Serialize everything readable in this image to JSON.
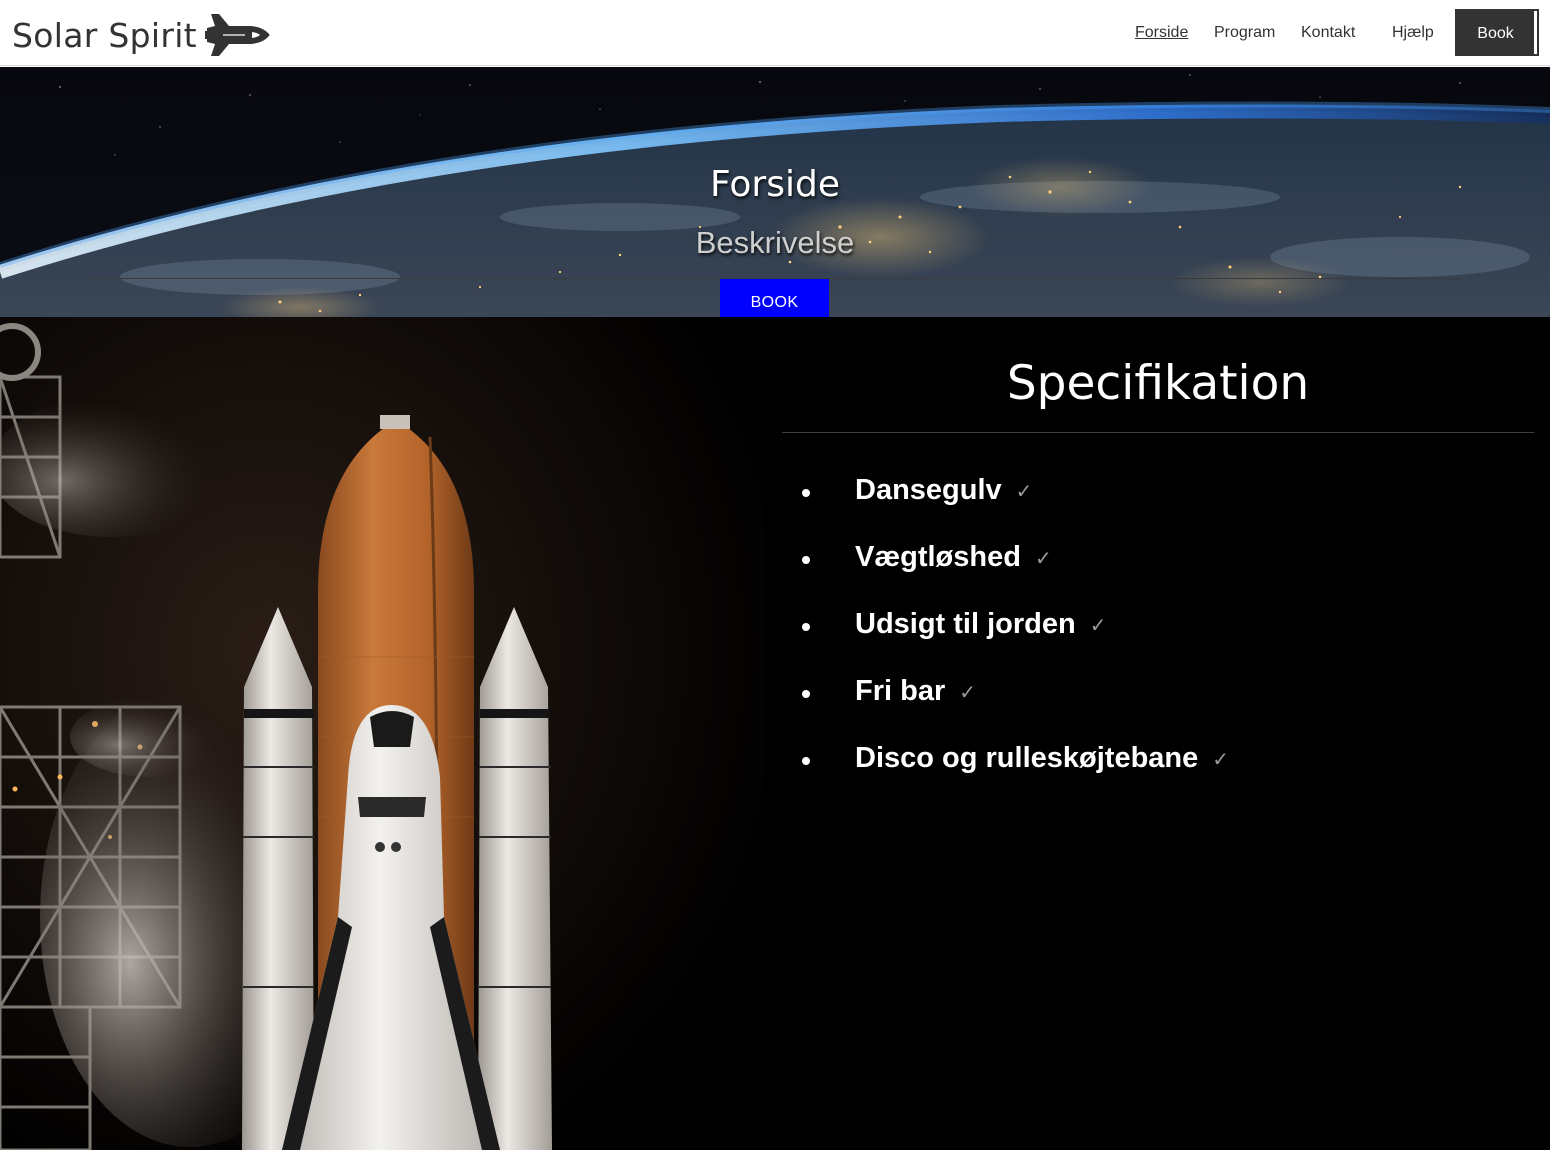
{
  "brand": {
    "name": "Solar Spirit",
    "logo_icon": "space-shuttle-icon"
  },
  "nav": {
    "items": [
      {
        "label": "Forside",
        "active": true
      },
      {
        "label": "Program",
        "active": false
      },
      {
        "label": "Kontakt",
        "active": false
      },
      {
        "label": "Hjælp",
        "active": false
      }
    ],
    "book_label": "Book"
  },
  "hero": {
    "title": "Forside",
    "subtitle": "Beskrivelse",
    "button_label": "BOOK",
    "button_color": "#0000ff",
    "background": "earth-from-orbit-at-night"
  },
  "main": {
    "image": "space-shuttle-launch-pad",
    "spec_title": "Specifikation",
    "items": [
      {
        "label": "Dansegulv",
        "icon": "check-icon"
      },
      {
        "label": "Vægtløshed",
        "icon": "check-icon"
      },
      {
        "label": "Udsigt til jorden",
        "icon": "check-icon"
      },
      {
        "label": "Fri bar",
        "icon": "check-icon"
      },
      {
        "label": "Disco og rulleskøjtebane",
        "icon": "check-icon"
      }
    ]
  },
  "colors": {
    "nav_text": "#333333",
    "nav_button_bg": "#333333",
    "page_dark": "#000000",
    "check": "#9a9a9a"
  }
}
